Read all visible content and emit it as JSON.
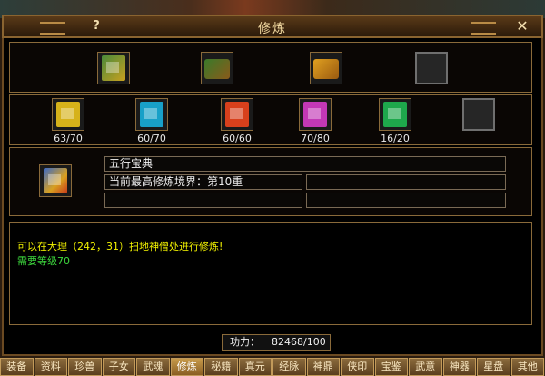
{
  "window": {
    "title": "修炼",
    "help_label": "?",
    "close_label": "✕"
  },
  "top_slots": [
    {
      "icon": "book-green-gold-icon"
    },
    {
      "icon": "scroll-bundle-icon"
    },
    {
      "icon": "gold-chest-icon"
    },
    {
      "icon": "empty-slot-icon"
    }
  ],
  "books": [
    {
      "icon": "yellow-book-icon",
      "color": "#d6b21a",
      "count": "63/70"
    },
    {
      "icon": "blue-book-icon",
      "color": "#18a0c8",
      "count": "60/70"
    },
    {
      "icon": "red-book-icon",
      "color": "#d8401c",
      "count": "60/60"
    },
    {
      "icon": "purple-book-icon",
      "color": "#c238b6",
      "count": "70/80"
    },
    {
      "icon": "green-book-icon",
      "color": "#1ea84c",
      "count": "16/20"
    },
    {
      "icon": "empty-slot-icon",
      "color": "#262626",
      "count": ""
    }
  ],
  "selected": {
    "icon": "five-element-book-icon",
    "name": "五行宝典",
    "realm": "当前最高修炼境界：第10重"
  },
  "info": {
    "location": "可以在大理（242，31）扫地神僧处进行修炼!",
    "requirement": "需要等级70"
  },
  "power": {
    "label": "功力：",
    "value": "82468/100"
  },
  "tabs": [
    "装备",
    "资料",
    "珍兽",
    "子女",
    "武魂",
    "修炼",
    "秘籍",
    "真元",
    "经脉",
    "神鼎",
    "侠印",
    "宝鉴",
    "武意",
    "神器",
    "星盘",
    "其他"
  ],
  "active_tab": "修炼",
  "colors": {
    "location_text": "#f2f200",
    "requirement_text": "#3edc3e"
  }
}
